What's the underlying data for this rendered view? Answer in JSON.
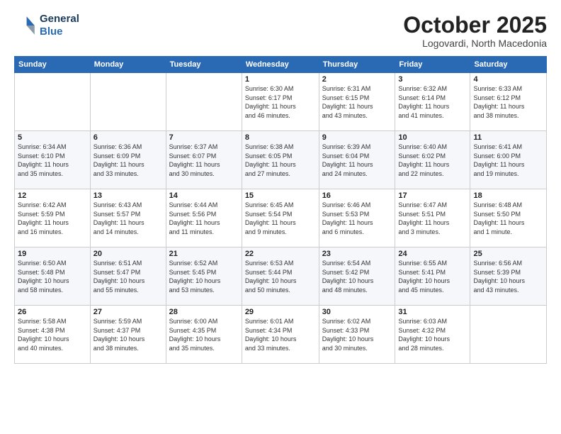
{
  "header": {
    "logo_line1": "General",
    "logo_line2": "Blue",
    "month": "October 2025",
    "location": "Logovardi, North Macedonia"
  },
  "weekdays": [
    "Sunday",
    "Monday",
    "Tuesday",
    "Wednesday",
    "Thursday",
    "Friday",
    "Saturday"
  ],
  "weeks": [
    [
      {
        "day": "",
        "info": ""
      },
      {
        "day": "",
        "info": ""
      },
      {
        "day": "",
        "info": ""
      },
      {
        "day": "1",
        "info": "Sunrise: 6:30 AM\nSunset: 6:17 PM\nDaylight: 11 hours\nand 46 minutes."
      },
      {
        "day": "2",
        "info": "Sunrise: 6:31 AM\nSunset: 6:15 PM\nDaylight: 11 hours\nand 43 minutes."
      },
      {
        "day": "3",
        "info": "Sunrise: 6:32 AM\nSunset: 6:14 PM\nDaylight: 11 hours\nand 41 minutes."
      },
      {
        "day": "4",
        "info": "Sunrise: 6:33 AM\nSunset: 6:12 PM\nDaylight: 11 hours\nand 38 minutes."
      }
    ],
    [
      {
        "day": "5",
        "info": "Sunrise: 6:34 AM\nSunset: 6:10 PM\nDaylight: 11 hours\nand 35 minutes."
      },
      {
        "day": "6",
        "info": "Sunrise: 6:36 AM\nSunset: 6:09 PM\nDaylight: 11 hours\nand 33 minutes."
      },
      {
        "day": "7",
        "info": "Sunrise: 6:37 AM\nSunset: 6:07 PM\nDaylight: 11 hours\nand 30 minutes."
      },
      {
        "day": "8",
        "info": "Sunrise: 6:38 AM\nSunset: 6:05 PM\nDaylight: 11 hours\nand 27 minutes."
      },
      {
        "day": "9",
        "info": "Sunrise: 6:39 AM\nSunset: 6:04 PM\nDaylight: 11 hours\nand 24 minutes."
      },
      {
        "day": "10",
        "info": "Sunrise: 6:40 AM\nSunset: 6:02 PM\nDaylight: 11 hours\nand 22 minutes."
      },
      {
        "day": "11",
        "info": "Sunrise: 6:41 AM\nSunset: 6:00 PM\nDaylight: 11 hours\nand 19 minutes."
      }
    ],
    [
      {
        "day": "12",
        "info": "Sunrise: 6:42 AM\nSunset: 5:59 PM\nDaylight: 11 hours\nand 16 minutes."
      },
      {
        "day": "13",
        "info": "Sunrise: 6:43 AM\nSunset: 5:57 PM\nDaylight: 11 hours\nand 14 minutes."
      },
      {
        "day": "14",
        "info": "Sunrise: 6:44 AM\nSunset: 5:56 PM\nDaylight: 11 hours\nand 11 minutes."
      },
      {
        "day": "15",
        "info": "Sunrise: 6:45 AM\nSunset: 5:54 PM\nDaylight: 11 hours\nand 9 minutes."
      },
      {
        "day": "16",
        "info": "Sunrise: 6:46 AM\nSunset: 5:53 PM\nDaylight: 11 hours\nand 6 minutes."
      },
      {
        "day": "17",
        "info": "Sunrise: 6:47 AM\nSunset: 5:51 PM\nDaylight: 11 hours\nand 3 minutes."
      },
      {
        "day": "18",
        "info": "Sunrise: 6:48 AM\nSunset: 5:50 PM\nDaylight: 11 hours\nand 1 minute."
      }
    ],
    [
      {
        "day": "19",
        "info": "Sunrise: 6:50 AM\nSunset: 5:48 PM\nDaylight: 10 hours\nand 58 minutes."
      },
      {
        "day": "20",
        "info": "Sunrise: 6:51 AM\nSunset: 5:47 PM\nDaylight: 10 hours\nand 55 minutes."
      },
      {
        "day": "21",
        "info": "Sunrise: 6:52 AM\nSunset: 5:45 PM\nDaylight: 10 hours\nand 53 minutes."
      },
      {
        "day": "22",
        "info": "Sunrise: 6:53 AM\nSunset: 5:44 PM\nDaylight: 10 hours\nand 50 minutes."
      },
      {
        "day": "23",
        "info": "Sunrise: 6:54 AM\nSunset: 5:42 PM\nDaylight: 10 hours\nand 48 minutes."
      },
      {
        "day": "24",
        "info": "Sunrise: 6:55 AM\nSunset: 5:41 PM\nDaylight: 10 hours\nand 45 minutes."
      },
      {
        "day": "25",
        "info": "Sunrise: 6:56 AM\nSunset: 5:39 PM\nDaylight: 10 hours\nand 43 minutes."
      }
    ],
    [
      {
        "day": "26",
        "info": "Sunrise: 5:58 AM\nSunset: 4:38 PM\nDaylight: 10 hours\nand 40 minutes."
      },
      {
        "day": "27",
        "info": "Sunrise: 5:59 AM\nSunset: 4:37 PM\nDaylight: 10 hours\nand 38 minutes."
      },
      {
        "day": "28",
        "info": "Sunrise: 6:00 AM\nSunset: 4:35 PM\nDaylight: 10 hours\nand 35 minutes."
      },
      {
        "day": "29",
        "info": "Sunrise: 6:01 AM\nSunset: 4:34 PM\nDaylight: 10 hours\nand 33 minutes."
      },
      {
        "day": "30",
        "info": "Sunrise: 6:02 AM\nSunset: 4:33 PM\nDaylight: 10 hours\nand 30 minutes."
      },
      {
        "day": "31",
        "info": "Sunrise: 6:03 AM\nSunset: 4:32 PM\nDaylight: 10 hours\nand 28 minutes."
      },
      {
        "day": "",
        "info": ""
      }
    ]
  ]
}
